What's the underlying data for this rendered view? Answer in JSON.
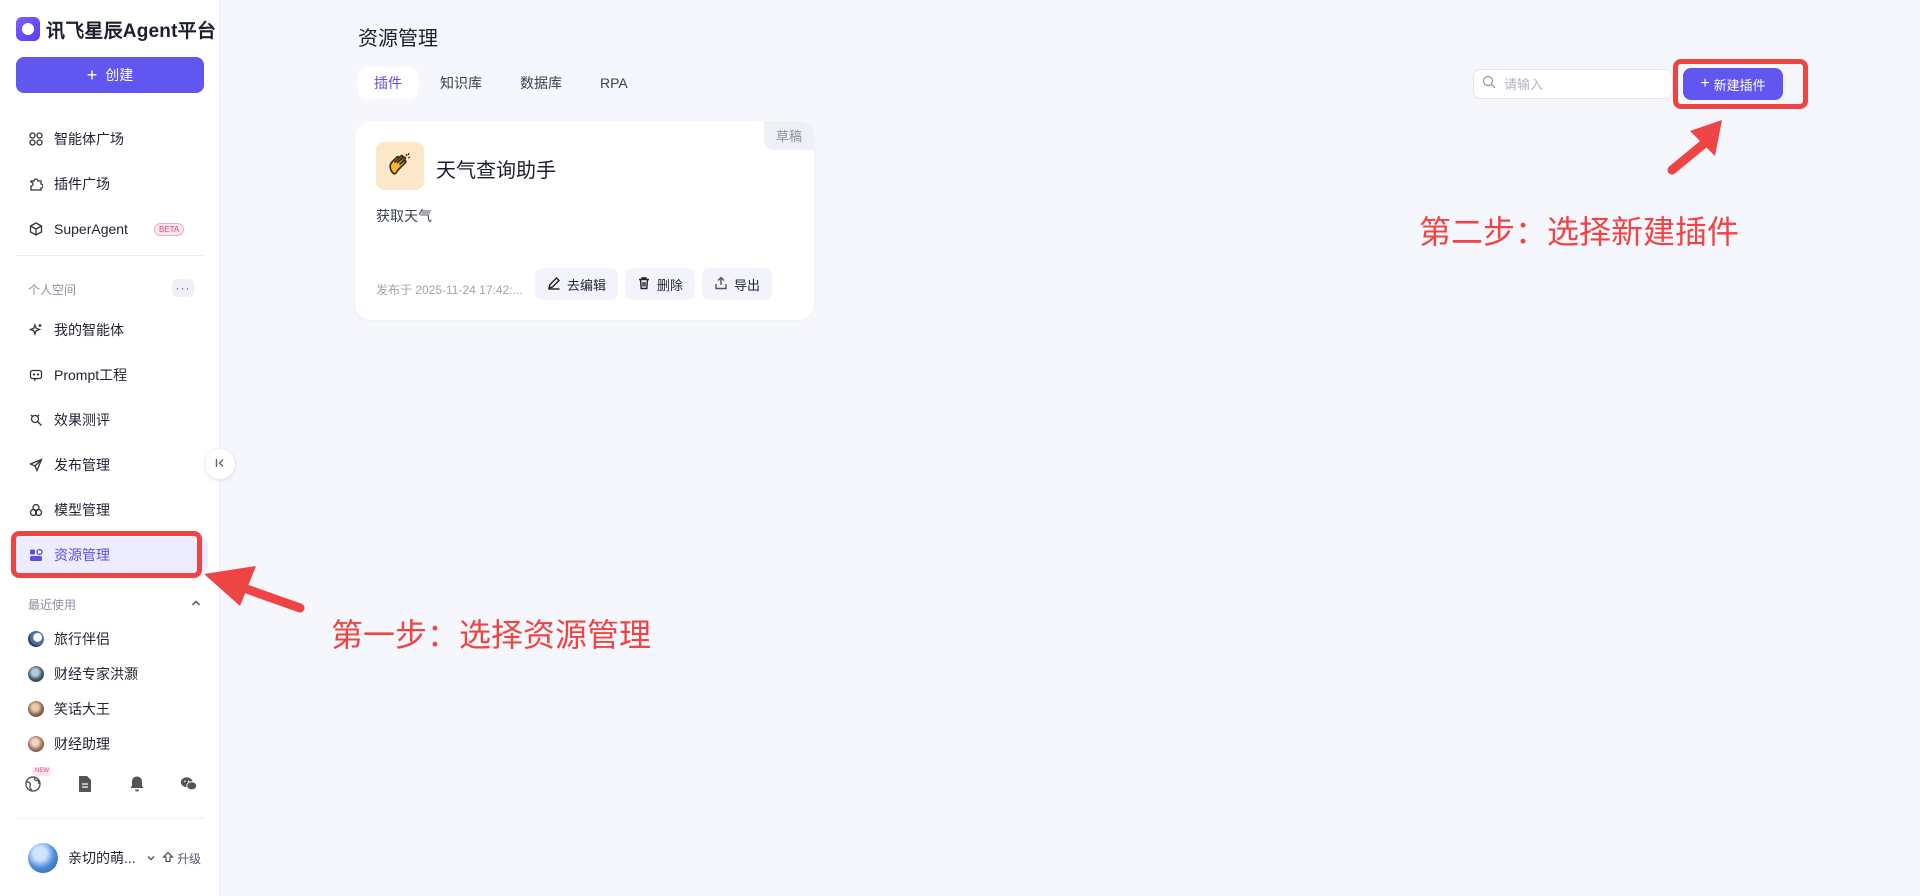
{
  "brand": {
    "name": "讯飞星辰Agent平台"
  },
  "sidebar": {
    "create_label": "创建",
    "nav_top": [
      {
        "label": "智能体广场",
        "icon": "grid-icon"
      },
      {
        "label": "插件广场",
        "icon": "puzzle-icon"
      },
      {
        "label": "SuperAgent",
        "icon": "hexagon-icon",
        "badge": "BETA"
      }
    ],
    "personal_space_label": "个人空间",
    "nav_personal": [
      {
        "label": "我的智能体",
        "icon": "sparkle-icon"
      },
      {
        "label": "Prompt工程",
        "icon": "chat-icon"
      },
      {
        "label": "效果测评",
        "icon": "evaluate-icon"
      },
      {
        "label": "发布管理",
        "icon": "send-icon"
      },
      {
        "label": "模型管理",
        "icon": "model-icon"
      },
      {
        "label": "资源管理",
        "icon": "resource-icon",
        "active": true
      }
    ],
    "recent_label": "最近使用",
    "recent": [
      {
        "label": "旅行伴侣"
      },
      {
        "label": "财经专家洪灏"
      },
      {
        "label": "笑话大王"
      },
      {
        "label": "财经助理"
      }
    ],
    "footer_new_tag": "NEW",
    "user_name": "亲切的萌...",
    "upgrade_label": "升级"
  },
  "main": {
    "title": "资源管理",
    "tabs": [
      {
        "label": "插件",
        "active": true
      },
      {
        "label": "知识库"
      },
      {
        "label": "数据库"
      },
      {
        "label": "RPA"
      }
    ],
    "search_placeholder": "请输入",
    "new_plugin_label": "新建插件",
    "card": {
      "status": "草稿",
      "title": "天气查询助手",
      "description": "获取天气",
      "date": "发布于 2025-11-24 17:42:...",
      "actions": {
        "edit": "去编辑",
        "delete": "删除",
        "export": "导出"
      }
    }
  },
  "annotations": {
    "step1": "第一步：选择资源管理",
    "step2": "第二步：选择新建插件",
    "color": "#ef4444"
  },
  "colors": {
    "accent": "#6256f0",
    "active_bg": "#eeecff"
  }
}
